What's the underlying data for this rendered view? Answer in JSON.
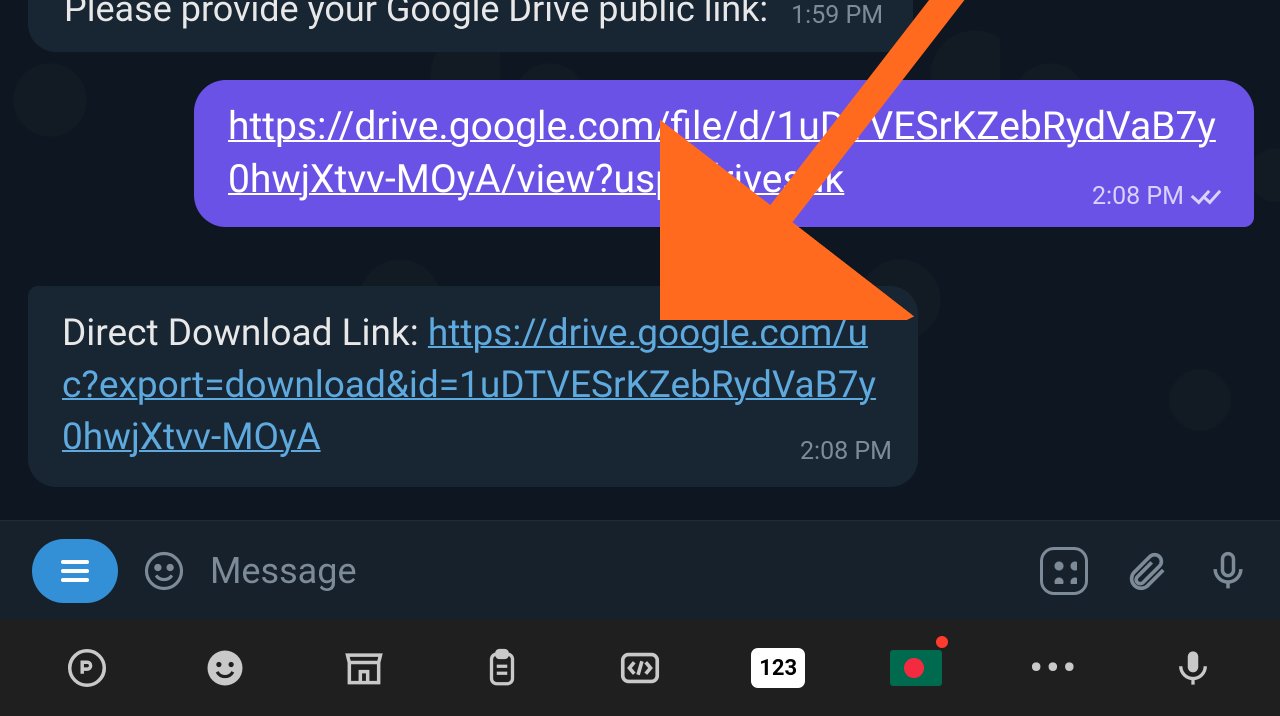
{
  "messages": {
    "incoming1": {
      "text": "Please provide your Google Drive public link:",
      "time": "1:59 PM"
    },
    "outgoing": {
      "link": "https://drive.google.com/file/d/1uDTVESrKZebRydVaB7y0hwjXtvv-MOyA/view?usp=drivesdk",
      "time": "2:08 PM"
    },
    "incoming2": {
      "prefix": "Direct Download Link: ",
      "link": "https://drive.google.com/uc?export=download&id=1uDTVESrKZebRydVaB7y0hwjXtvv-MOyA",
      "time": "2:08 PM"
    }
  },
  "input": {
    "placeholder": "Message"
  },
  "keyboard": {
    "numbox": "123"
  },
  "colors": {
    "outgoing_bubble": "#6b52e6",
    "incoming_bubble": "#182533",
    "link_in": "#5ea9dd",
    "arrow": "#ff6a1f"
  }
}
